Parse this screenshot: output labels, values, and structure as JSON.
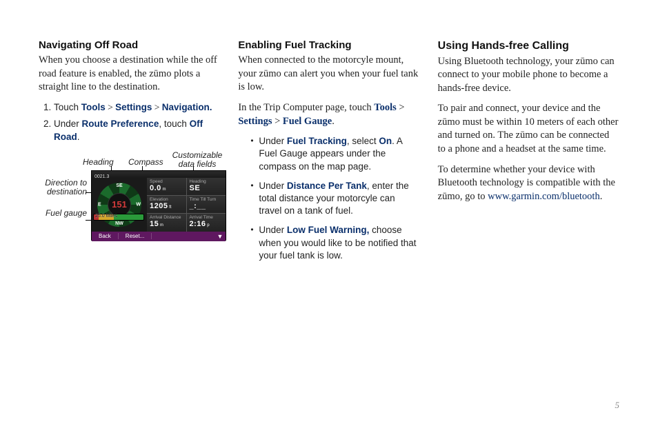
{
  "col1": {
    "h": "Navigating Off Road",
    "p1_a": "When you choose a destination while the off road feature is enabled, the z",
    "p1_b": "mo plots a straight line to the destination.",
    "steps": {
      "s1": {
        "pre": "Touch ",
        "tools": "Tools",
        "gt1": " > ",
        "settings": "Settings",
        "gt2": " > ",
        "nav": "Navigation."
      },
      "s2": {
        "pre": "Under ",
        "rp": "Route Preference",
        "mid": ", touch ",
        "or1": "Off",
        "or2": "Road",
        "end": "."
      }
    },
    "fig": {
      "heading": "Heading",
      "compass": "Compass",
      "custom": "Customizable data fields",
      "dir": "Direction to destination",
      "fuel": "Fuel gauge",
      "center": "151",
      "cells": {
        "c1l": "Speed",
        "c1v": "0.0",
        "c2l": "Heading",
        "c2v": "SE",
        "c3l": "Elevation",
        "c3v": "1205",
        "c4l": "Time Till Turn",
        "c4v": "_:__",
        "c5l": "Arrival Distance",
        "c5v": "15",
        "c6l": "Arrival Time",
        "c6v": "2:16"
      },
      "topbar": "0021.3",
      "fuelstrip": "25.0 Miles",
      "back": "Back",
      "reset": "Reset...",
      "arrow": "▼"
    }
  },
  "col2": {
    "h": "Enabling Fuel Tracking",
    "p1_a": "When connected to the motorcyle mount, your z",
    "p1_b": "mo can alert you when your fuel tank is low.",
    "p2_a": "In the Trip Computer page, touch ",
    "tools": "Tools",
    "gt1": " > ",
    "settings": "Settings",
    "gt2": " > ",
    "fg": "Fuel Gauge",
    "p2_end": ".",
    "b1": {
      "pre": "Under ",
      "ft": "Fuel Tracking",
      "mid": ", select ",
      "on": "On",
      "end": ". A Fuel Gauge appears under the compass on the map page."
    },
    "b2": {
      "pre": "Under ",
      "dpt": "Distance Per Tank",
      "end": ", enter the total distance your motorcyle can travel on a tank of fuel."
    },
    "b3": {
      "pre": "Under ",
      "lfw": "Low Fuel Warning,",
      "end": " choose when you would like to be notified that your fuel tank is low."
    }
  },
  "col3": {
    "h": "Using Hands-free Calling",
    "p1_a": "Using Bluetooth technology, your z",
    "p1_b": "mo can connect to your mobile phone to become a hands-free device.",
    "p2_a": "To pair and connect, your device and the z",
    "p2_b": "mo must be within 10 meters of each other and turned on. The z",
    "p2_c": "mo can be connected to a phone and a headset at the same time.",
    "p3_a": "To determine whether your device with Bluetooth technology is compatible with the z",
    "p3_b": "mo, go to ",
    "link": "www.garmin.com/bluetooth",
    "p3_c": "."
  },
  "pagenum": "5"
}
